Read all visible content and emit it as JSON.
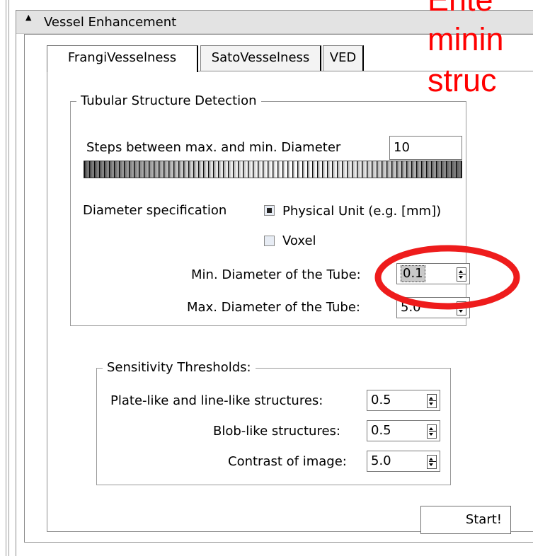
{
  "panel": {
    "title": "Vessel Enhancement"
  },
  "tabs": [
    {
      "label": "FrangiVesselness",
      "active": true
    },
    {
      "label": "SatoVesselness",
      "active": false
    },
    {
      "label": "VED",
      "active": false
    }
  ],
  "tubular": {
    "legend": "Tubular Structure Detection",
    "steps_label": "Steps between max. and min. Diameter",
    "steps_value": "10",
    "diameter_spec_label": "Diameter specification",
    "options": [
      {
        "label": "Physical Unit (e.g. [mm])",
        "checked": true
      },
      {
        "label": "Voxel",
        "checked": false
      }
    ],
    "min_label": "Min. Diameter of the Tube:",
    "min_value": "0.1",
    "max_label": "Max. Diameter of the Tube:",
    "max_value": "5.0"
  },
  "sensitivity": {
    "legend": "Sensitivity Thresholds:",
    "rows": [
      {
        "label": "Plate-like and line-like structures:",
        "value": "0.5"
      },
      {
        "label": "Blob-like structures:",
        "value": "0.5"
      },
      {
        "label": "Contrast of image:",
        "value": "5.0"
      }
    ]
  },
  "start_label": "Start!",
  "annotation": {
    "lines": [
      "Ente",
      "minin",
      "struc"
    ],
    "color": "#ff0000"
  },
  "icons": {
    "collapse": "collapse-triangle-icon",
    "spin": "spin-arrows-icon"
  }
}
